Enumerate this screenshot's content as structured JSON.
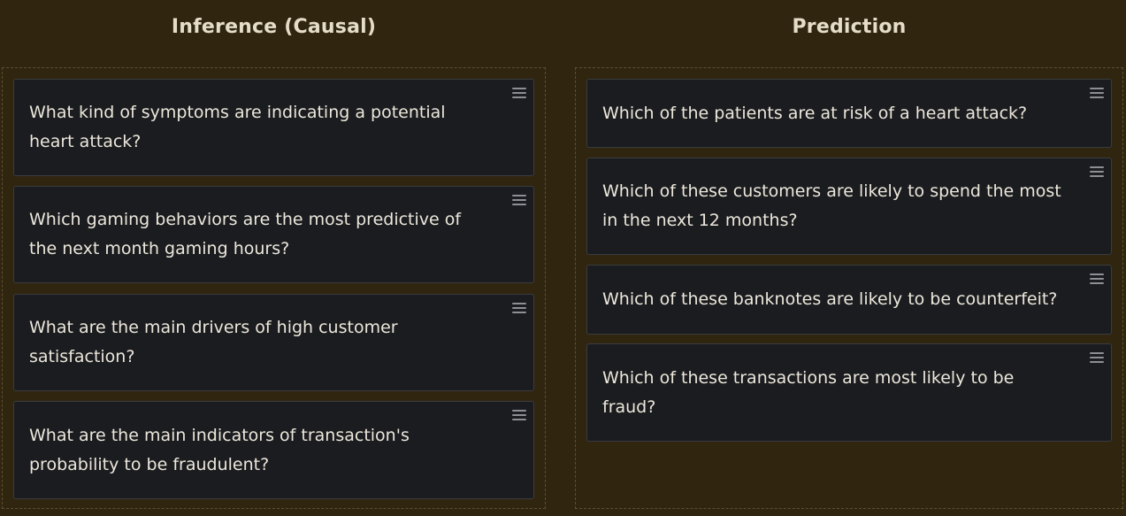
{
  "columns": [
    {
      "title": "Inference (Causal)",
      "cards": [
        {
          "text": "What kind of symptoms are indicating a potential heart attack?"
        },
        {
          "text": "Which gaming behaviors are the most predictive of the next month gaming hours?"
        },
        {
          "text": "What are the main drivers of high customer satisfaction?"
        },
        {
          "text": "What are the main indicators of transaction's probability to be fraudulent?"
        }
      ]
    },
    {
      "title": "Prediction",
      "cards": [
        {
          "text": "Which of the patients are at risk of a heart attack?"
        },
        {
          "text": "Which of these customers are likely to spend the most in the next 12 months?"
        },
        {
          "text": "Which of these banknotes are likely to be counterfeit?"
        },
        {
          "text": "Which of these transactions are most likely to be fraud?"
        }
      ]
    }
  ],
  "drag_handle_icon": "drag-handle-icon",
  "colors": {
    "background": "#302610",
    "card": "#1b1c1f",
    "title_text": "#e6ddc8",
    "card_text": "#ece7dc"
  }
}
